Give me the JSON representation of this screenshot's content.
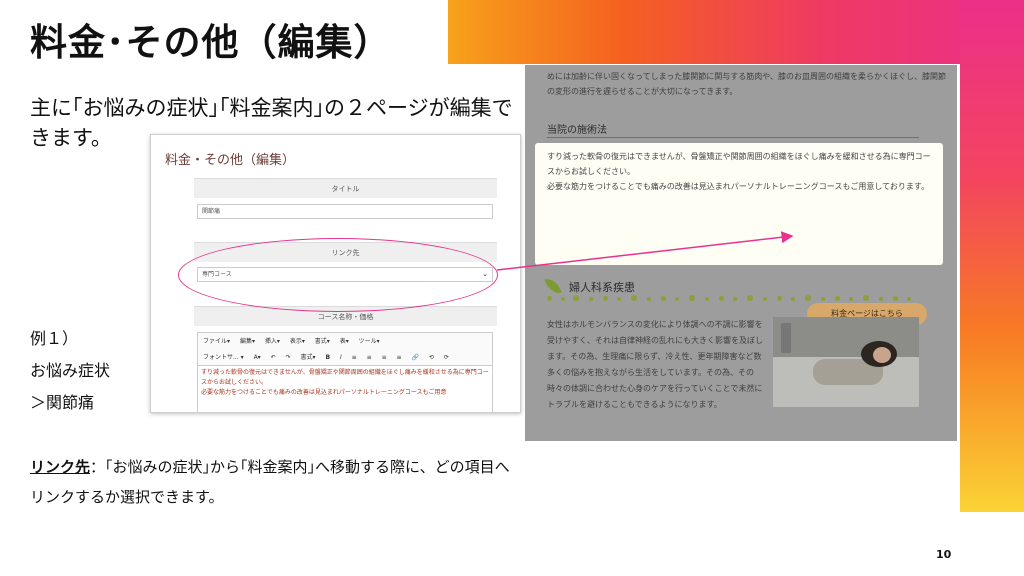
{
  "slide": {
    "title": "料金･その他（編集）",
    "lead": "主に｢お悩みの症状｣｢料金案内｣の２ページが編集できます。",
    "example_lines": [
      "例１）",
      "お悩み症状",
      "＞関節痛"
    ],
    "note_label": "リンク先",
    "note_text": "：｢お悩みの症状｣から｢料金案内｣へ移動する際に、どの項目へリンクするか選択できます。",
    "page_number": "10",
    "colors": {
      "gradient_start": "#f7a21b",
      "gradient_mid": "#ee3a64",
      "gradient_end": "#fbd335",
      "highlight": "#e7338f"
    }
  },
  "editor": {
    "heading": "料金・その他（編集）",
    "title_section": "タイトル",
    "title_value": "関節痛",
    "link_section": "リンク先",
    "link_value": "専門コース",
    "course_section": "コース名称・価格",
    "toolbar_row1": [
      "ファイル▾",
      "編集▾",
      "挿入▾",
      "表示▾",
      "書式▾",
      "表▾",
      "ツール▾"
    ],
    "toolbar_row2": [
      "フォントサ... ▾",
      "A▾",
      "↶",
      "↷",
      "書式▾",
      "B",
      "I",
      "≡",
      "≡",
      "≡",
      "≡",
      "🔗",
      "⟲",
      "⟳"
    ],
    "body_lines": [
      "すり減った軟骨の復元はできませんが、骨盤矯正や関節周囲の組織をほぐし痛みを緩和させる為に専門コースからお試しください。",
      "必要な筋力をつけることでも痛みの改善は見込まれパーソナルトレーニングコースもご用意"
    ]
  },
  "preview": {
    "top_text": "めには加齢に伴い固くなってしまった膝関節に関与する筋肉や、膝のお皿周囲の組織を柔らかくほぐし、膝関節の変形の進行を遅らせることが大切になってきます。",
    "section_title": "当院の施術法",
    "card_text": [
      "すり減った軟骨の復元はできませんが、骨盤矯正や関節周囲の組織をほぐし痛みを緩和させる為に専門コースからお試しください。",
      "必要な筋力をつけることでも痛みの改善は見込まれパーソナルトレーニングコースもご用意しております。"
    ],
    "price_button": "料金ページはこちら",
    "category_title": "婦人科系疾患",
    "body_text": "女性はホルモンバランスの変化により体調への不調に影響を受けやすく、それは自律神経の乱れにも大きく影響を及ぼします。その為、生理痛に限らず、冷え性、更年期障害など数多くの悩みを抱えながら生活をしています。その為、その時々の体調に合わせた心身のケアを行っていくことで未然にトラブルを避けることもできるようになります。"
  }
}
